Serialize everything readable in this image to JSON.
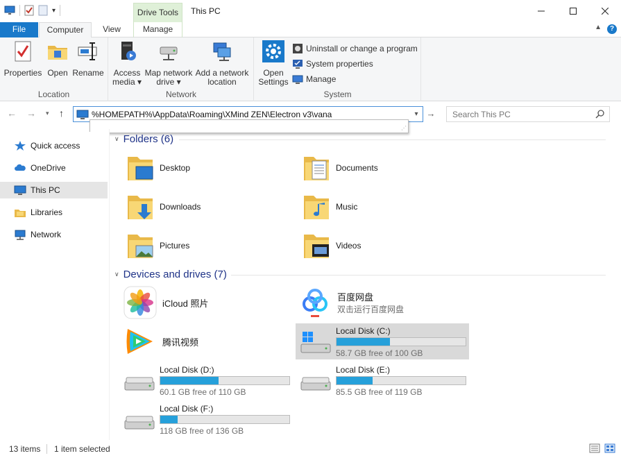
{
  "window": {
    "title": "This PC",
    "context_tab_group": "Drive Tools",
    "controls": {
      "minimize": "—",
      "maximize": "☐",
      "close": "✕"
    }
  },
  "ribbon_tabs": [
    "File",
    "Computer",
    "View",
    "Manage"
  ],
  "ribbon": {
    "location": {
      "label": "Location",
      "buttons": [
        "Properties",
        "Open",
        "Rename"
      ]
    },
    "network": {
      "label": "Network",
      "access_media": [
        "Access",
        "media ▾"
      ],
      "map_drive": [
        "Map network",
        "drive ▾"
      ],
      "add_location": [
        "Add a network",
        "location"
      ]
    },
    "system": {
      "label": "System",
      "open_settings": [
        "Open",
        "Settings"
      ],
      "uninstall": "Uninstall or change a program",
      "system_properties": "System properties",
      "manage": "Manage"
    }
  },
  "address_bar": {
    "value": "%HOMEPATH%\\AppData\\Roaming\\XMind ZEN\\Electron v3\\vana",
    "search_placeholder": "Search This PC"
  },
  "nav_pane": {
    "items": [
      {
        "label": "Quick access",
        "icon": "star-icon"
      },
      {
        "label": "OneDrive",
        "icon": "cloud-icon"
      },
      {
        "label": "This PC",
        "icon": "computer-icon",
        "selected": true
      },
      {
        "label": "Libraries",
        "icon": "library-icon"
      },
      {
        "label": "Network",
        "icon": "network-icon"
      }
    ]
  },
  "folders_section": {
    "heading": "Folders (6)",
    "items": [
      "Desktop",
      "Documents",
      "Downloads",
      "Music",
      "Pictures",
      "Videos"
    ]
  },
  "drives_section": {
    "heading": "Devices and drives (7)",
    "apps": [
      {
        "name": "iCloud 照片"
      },
      {
        "name": "百度网盘",
        "sub": "双击运行百度网盘"
      },
      {
        "name": "腾讯视频"
      }
    ],
    "drives": [
      {
        "name": "Local Disk (C:)",
        "free": "58.7 GB free of 100 GB",
        "used_fraction": 0.413,
        "selected": true
      },
      {
        "name": "Local Disk (D:)",
        "free": "60.1 GB free of 110 GB",
        "used_fraction": 0.454
      },
      {
        "name": "Local Disk (E:)",
        "free": "85.5 GB free of 119 GB",
        "used_fraction": 0.282
      },
      {
        "name": "Local Disk (F:)",
        "free": "118 GB free of 136 GB",
        "used_fraction": 0.132
      }
    ]
  },
  "status_bar": {
    "item_count": "13 items",
    "selection": "1 item selected"
  }
}
